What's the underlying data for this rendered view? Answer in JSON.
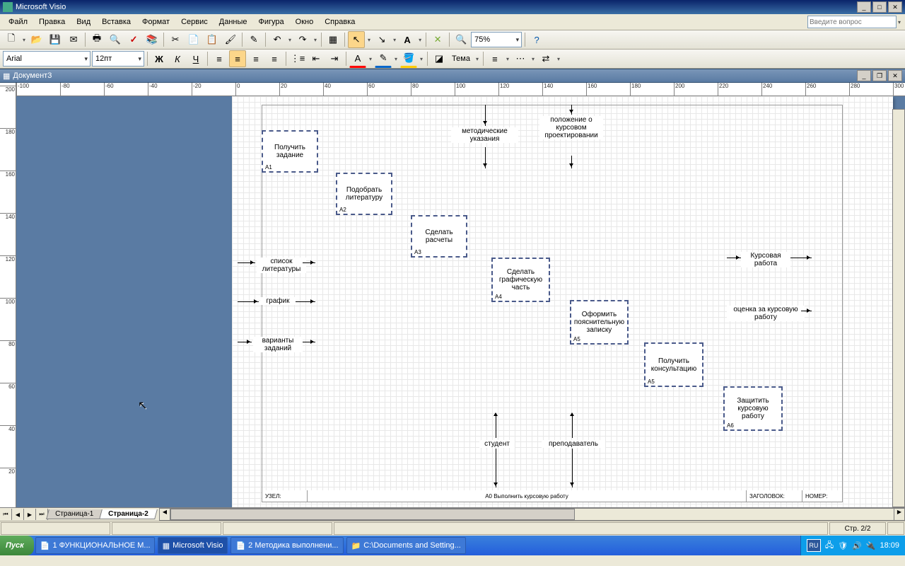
{
  "app": {
    "title": "Microsoft Visio"
  },
  "window_controls": {
    "min": "_",
    "max": "□",
    "close": "✕"
  },
  "menu": [
    "Файл",
    "Правка",
    "Вид",
    "Вставка",
    "Формат",
    "Сервис",
    "Данные",
    "Фигура",
    "Окно",
    "Справка"
  ],
  "question_box": "Введите вопрос",
  "font": {
    "name": "Arial",
    "size": "12пт"
  },
  "zoom": "75%",
  "theme_label": "Тема",
  "doc": {
    "title": "Документ3"
  },
  "ruler_h": [
    "-100",
    "-80",
    "-60",
    "-40",
    "-20",
    "0",
    "20",
    "40",
    "60",
    "80",
    "100",
    "120",
    "140",
    "160",
    "180",
    "200",
    "220",
    "240",
    "260",
    "280",
    "300"
  ],
  "ruler_v": [
    "200",
    "180",
    "160",
    "140",
    "120",
    "100",
    "80",
    "60",
    "40",
    "20"
  ],
  "blocks": {
    "a1": {
      "text": "Получить задание",
      "id": "A1"
    },
    "a2": {
      "text": "Подобрать литературу",
      "id": "A2"
    },
    "a3": {
      "text": "Сделать расчеты",
      "id": "A3"
    },
    "a4": {
      "text": "Сделать графическую часть",
      "id": "A4"
    },
    "a5": {
      "text": "Оформить пояснительную записку",
      "id": "A5"
    },
    "a5b": {
      "text": "Получить консультацию",
      "id": "A5"
    },
    "a6": {
      "text": "Защитить курсовую работу",
      "id": "A6"
    }
  },
  "labels": {
    "metod": "методические указания",
    "poloz": "положение о курсовом проектировании",
    "spisok": "список литературы",
    "grafik": "график",
    "varianty": "варианты заданий",
    "student": "студент",
    "prepod": "преподаватель",
    "kursovaya": "Курсовая работа",
    "ocenka": "оценка за курсовую работу"
  },
  "footer": {
    "uzel": "УЗЕЛ:",
    "center": "А0 Выполнить курсовую работу",
    "zagolovok": "ЗАГОЛОВОК:",
    "nomer": "НОМЕР:"
  },
  "tabs": [
    "Страница-1",
    "Страница-2"
  ],
  "status": {
    "page": "Стр. 2/2"
  },
  "taskbar": {
    "start": "Пуск",
    "items": [
      "1 ФУНКЦИОНАЛЬНОЕ М...",
      "Microsoft Visio",
      "2 Методика выполнени...",
      "C:\\Documents and Setting..."
    ],
    "lang": "RU",
    "time": "18:09"
  }
}
